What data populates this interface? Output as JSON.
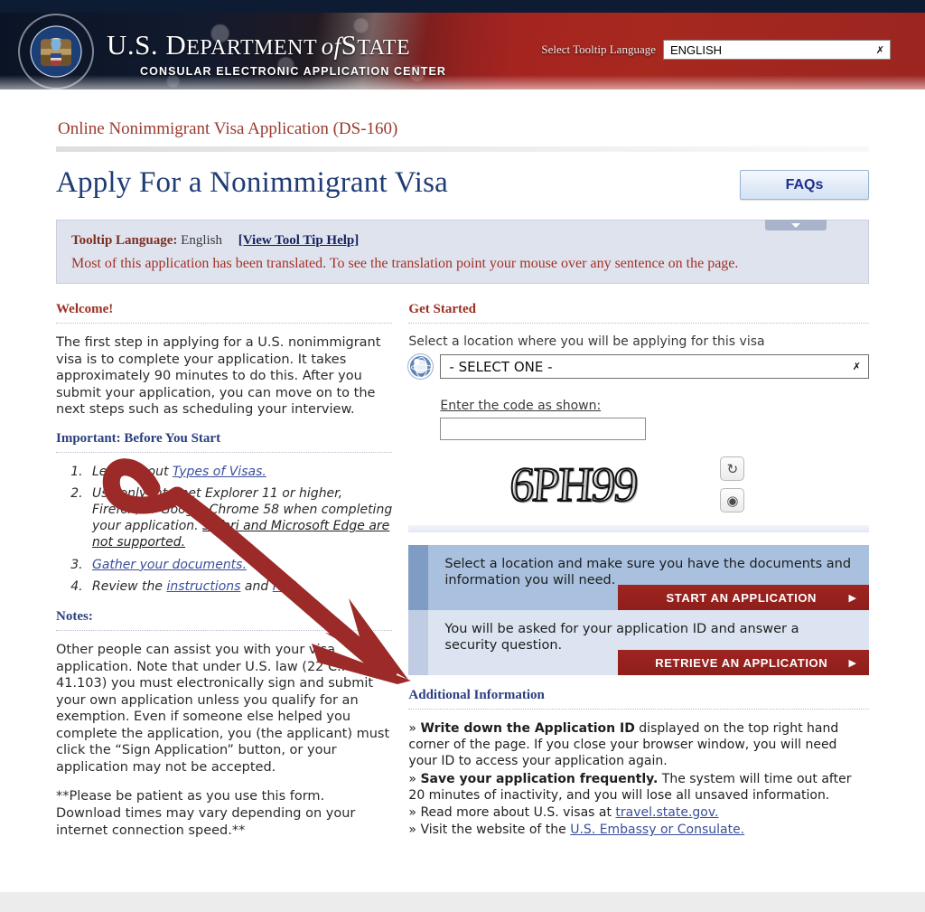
{
  "header": {
    "dept_line1_a": "U.S. D",
    "dept_line1_b": "EPARTMENT",
    "dept_line1_c": "of",
    "dept_line1_d": "S",
    "dept_line1_e": "TATE",
    "dept_sub": "CONSULAR ELECTRONIC APPLICATION CENTER",
    "lang_label": "Select Tooltip Language",
    "lang_value": "ENGLISH",
    "seal_alt": "great-seal-of-the-united-states"
  },
  "page": {
    "subtitle": "Online Nonimmigrant Visa Application (DS-160)",
    "title": "Apply For a Nonimmigrant Visa",
    "faq_button": "FAQs"
  },
  "tooltip_panel": {
    "label": "Tooltip Language:",
    "value": "English",
    "help_link": "[View Tool Tip Help]",
    "message": "Most of this application has been translated. To see the translation point your mouse over any sentence on the page."
  },
  "welcome": {
    "heading": "Welcome!",
    "paragraph": "The first step in applying for a U.S. nonimmigrant visa is to complete your application. It takes approximately 90 minutes to do this. After you submit your application, you can move on to the next steps such as scheduling your interview."
  },
  "important": {
    "heading": "Important: Before You Start",
    "items": [
      {
        "pre": "Learn about ",
        "link": "Types of Visas.",
        "post": ""
      },
      {
        "pre": "Use only Internet Explorer 11 or higher, Firefox, or Google Chrome 58 when completing your application. ",
        "link_dark": "Safari and Microsoft Edge are not supported.",
        "post": ""
      },
      {
        "pre": "",
        "link": "Gather your documents.",
        "post": ""
      },
      {
        "pre": "Review the ",
        "link": "instructions",
        "mid": " and ",
        "link2": "FAQ.",
        "post": ""
      }
    ]
  },
  "notes": {
    "heading": "Notes:",
    "paragraph1": "Other people can assist you with your visa application. Note that under U.S. law (22 C.F.R. 41.103) you must electronically sign and submit your own application unless you qualify for an exemption. Even if someone else helped you complete the application, you (the applicant) must click the “Sign Application” button, or your application may not be accepted.",
    "paragraph2": "**Please be patient as you use this form. Download times may vary depending on your internet connection speed.**"
  },
  "get_started": {
    "heading": "Get Started",
    "location_label": "Select a location where you will be applying for this visa",
    "location_value": "- SELECT ONE -",
    "code_label": "Enter the code as shown:",
    "code_value": "",
    "captcha_text": "6PH99",
    "refresh_icon": "↻",
    "audio_icon": "◉"
  },
  "actions": [
    {
      "text": "Select a location and make sure you have the documents and information you will need.",
      "button": "START AN APPLICATION",
      "arrow": "▶"
    },
    {
      "text": "You will be asked for your application ID and answer a security question.",
      "button": "RETRIEVE AN APPLICATION",
      "arrow": "▶"
    }
  ],
  "additional": {
    "heading": "Additional Information",
    "bullet": "»",
    "lines": [
      {
        "bold": "Write down the Application ID",
        "rest": " displayed on the top right hand corner of the page. If you close your browser window, you will need your ID to access your application again."
      },
      {
        "bold": "Save your application frequently.",
        "rest": " The system will time out after 20 minutes of inactivity, and you will lose all unsaved information."
      },
      {
        "bold": "",
        "rest": "Read more about U.S. visas at ",
        "link": "travel.state.gov."
      },
      {
        "bold": "",
        "rest": "Visit the website of the ",
        "link": "U.S. Embassy or Consulate."
      }
    ]
  },
  "annotation": {
    "color": "#9b2a28",
    "type": "hand-drawn-arrow",
    "points_to": "retrieve-an-application-panel"
  }
}
